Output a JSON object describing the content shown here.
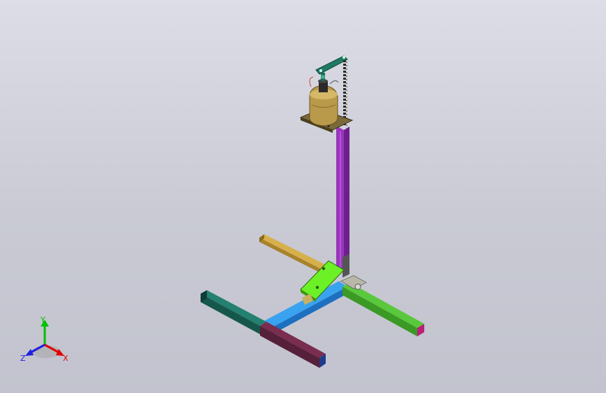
{
  "viewport": {
    "background_top": "#dcdde6",
    "background_bottom": "#c2c3ce"
  },
  "model_parts": [
    {
      "name": "vertical-post",
      "color": "#8e2bb0"
    },
    {
      "name": "motor-mount-plate",
      "color": "#6b5a2e"
    },
    {
      "name": "motor-housing",
      "color": "#b99a4a"
    },
    {
      "name": "top-arm",
      "color": "#1e6d58"
    },
    {
      "name": "base-leg-yellow",
      "color": "#c8a23e"
    },
    {
      "name": "base-leg-teal",
      "color": "#1f6e60"
    },
    {
      "name": "base-leg-maroon",
      "color": "#6b2642"
    },
    {
      "name": "base-leg-blue",
      "color": "#2d8fe0"
    },
    {
      "name": "base-leg-green",
      "color": "#4cb832"
    },
    {
      "name": "pedal-plate",
      "color": "#66ee22"
    }
  ],
  "triad": {
    "x_label": "X",
    "y_label": "Y",
    "z_label": "Z",
    "x_color": "#e00000",
    "y_color": "#00c000",
    "z_color": "#2020e0"
  }
}
